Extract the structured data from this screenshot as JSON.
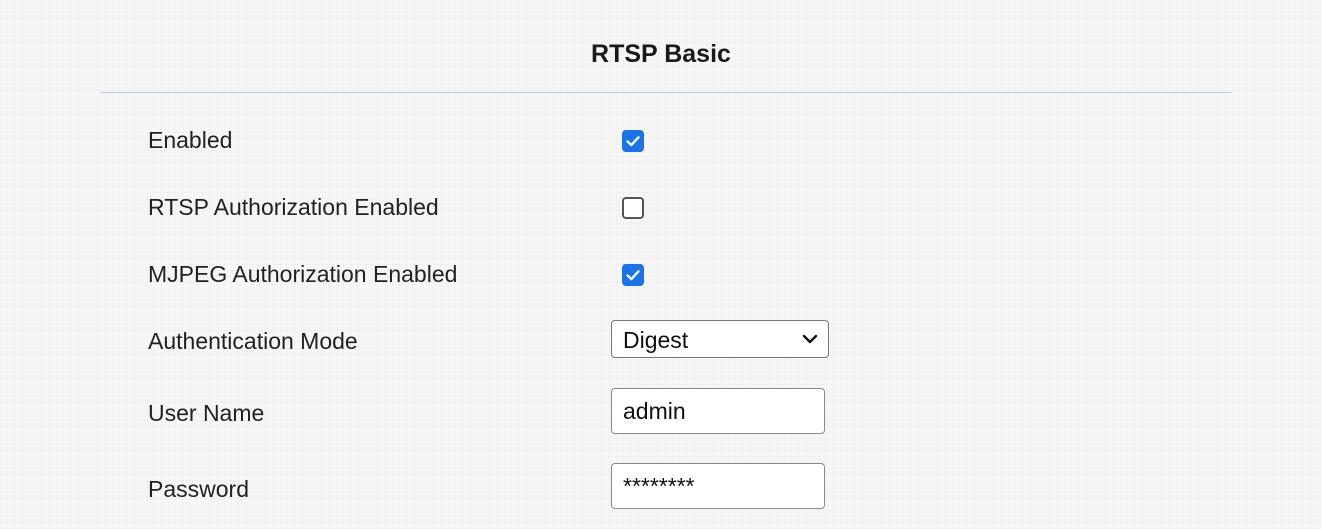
{
  "section": {
    "title": "RTSP Basic"
  },
  "fields": {
    "enabled": {
      "label": "Enabled",
      "checked": true
    },
    "rtsp_auth": {
      "label": "RTSP Authorization Enabled",
      "checked": false
    },
    "mjpeg_auth": {
      "label": "MJPEG Authorization Enabled",
      "checked": true
    },
    "auth_mode": {
      "label": "Authentication Mode",
      "value": "Digest"
    },
    "user_name": {
      "label": "User Name",
      "value": "admin"
    },
    "password": {
      "label": "Password",
      "value": "********"
    }
  },
  "colors": {
    "checkbox_checked": "#1a73e8",
    "divider": "#b9cde0"
  },
  "icons": {
    "check": "check-icon",
    "dropdown": "chevron-down-icon"
  }
}
